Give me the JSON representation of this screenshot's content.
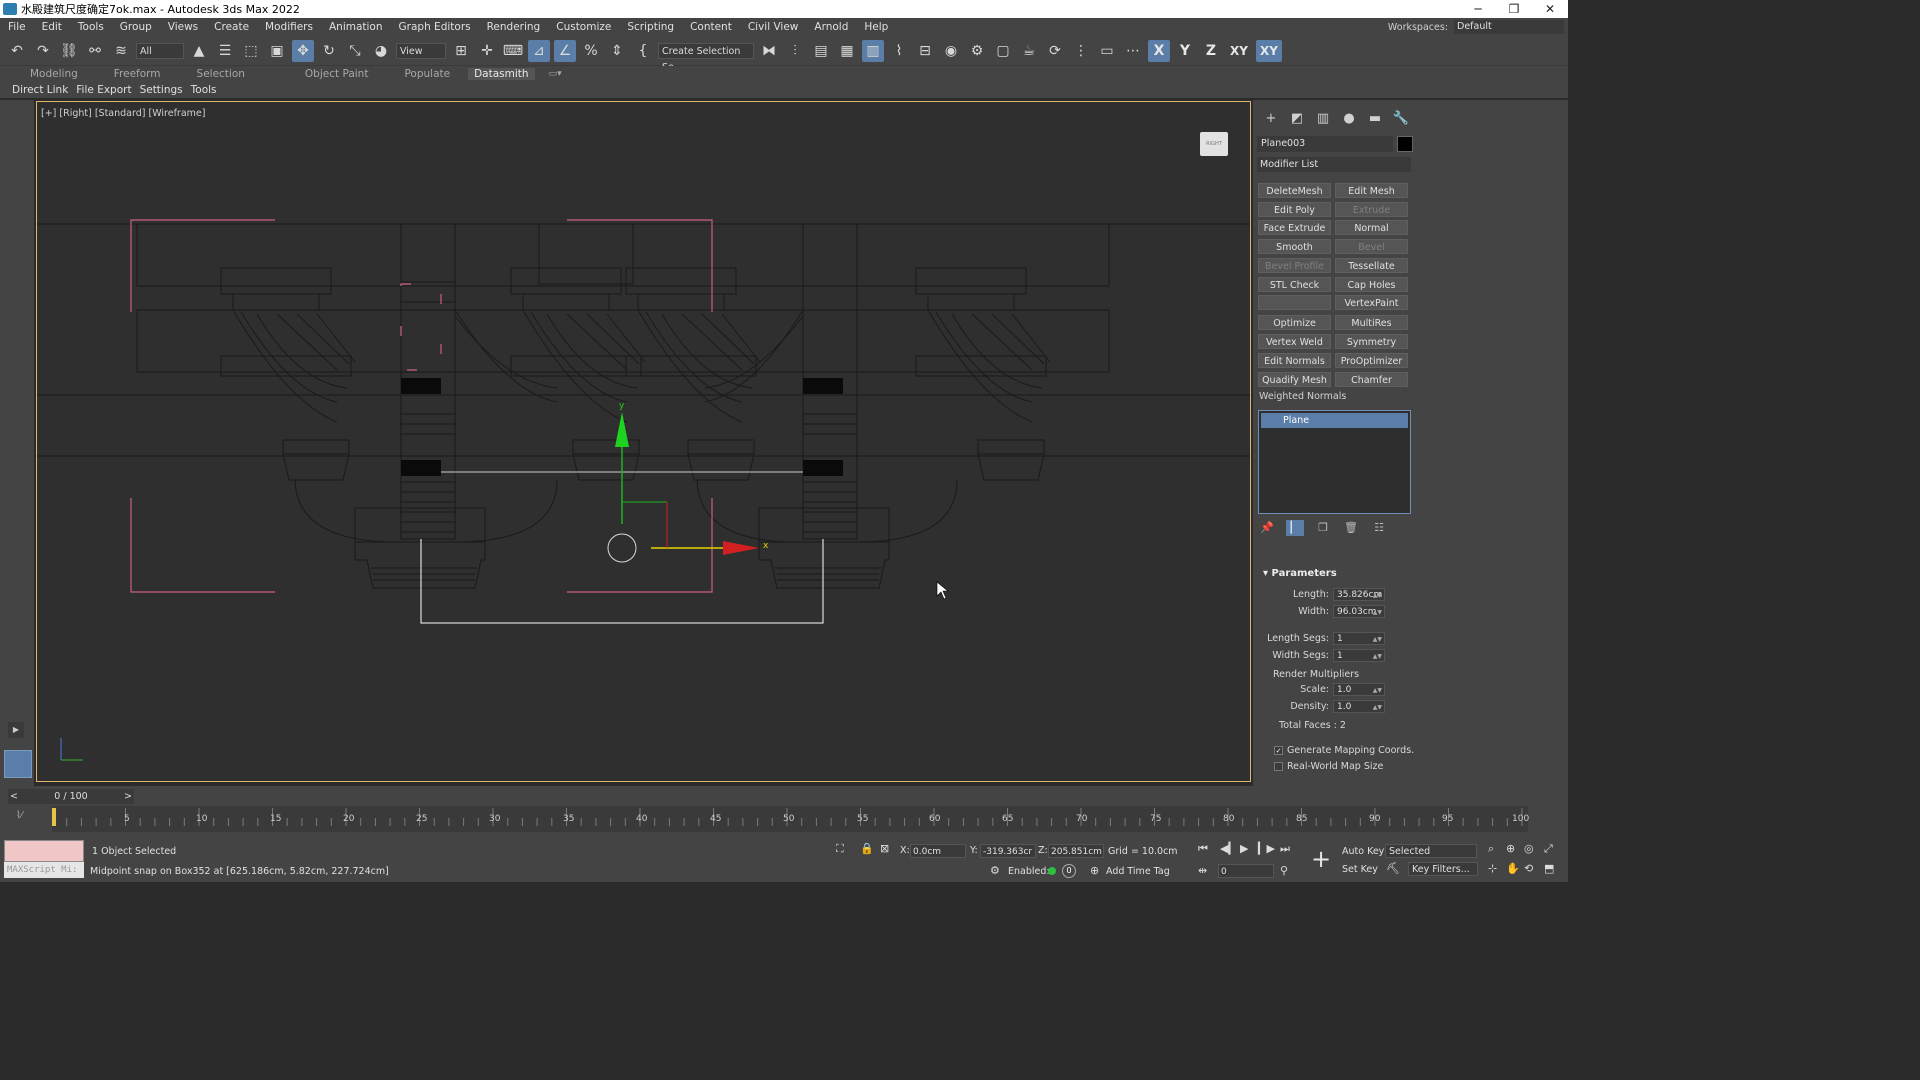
{
  "window": {
    "title": "水殿建筑尺度确定7ok.max - Autodesk 3ds Max 2022",
    "minimize": "─",
    "restore": "❐",
    "close": "✕"
  },
  "menu": [
    "File",
    "Edit",
    "Tools",
    "Group",
    "Views",
    "Create",
    "Modifiers",
    "Animation",
    "Graph Editors",
    "Rendering",
    "Customize",
    "Scripting",
    "Content",
    "Civil View",
    "Arnold",
    "Help"
  ],
  "workspaces": {
    "label": "Workspaces:",
    "value": "Default"
  },
  "toolbar": {
    "filter_value": "All",
    "coord_system": "View",
    "selection_set_placeholder": "Create Selection Se",
    "axis": [
      "X",
      "Y",
      "Z",
      "XY",
      "XY"
    ]
  },
  "ribbon_tabs": [
    "Modeling",
    "Freeform",
    "Selection",
    "Object Paint",
    "Populate",
    "Datasmith"
  ],
  "ribbon_active": "Datasmith",
  "datasmith_menu": [
    "Direct Link",
    "File Export",
    "Settings",
    "Tools"
  ],
  "viewport": {
    "label": "[+] [Right] [Standard] [Wireframe]",
    "viewcube_label": "RIGHT",
    "gizmo_x": "x",
    "gizmo_y": "y"
  },
  "command_panel": {
    "object_name": "Plane003",
    "object_color": "#000000",
    "modifier_list": "Modifier List",
    "modifier_buttons": [
      {
        "label": "DeleteMesh",
        "enabled": true
      },
      {
        "label": "Edit Mesh",
        "enabled": true
      },
      {
        "label": "Edit Poly",
        "enabled": true
      },
      {
        "label": "Extrude",
        "enabled": false
      },
      {
        "label": "Face Extrude",
        "enabled": true
      },
      {
        "label": "Normal",
        "enabled": true
      },
      {
        "label": "Smooth",
        "enabled": true
      },
      {
        "label": "Bevel",
        "enabled": false
      },
      {
        "label": "Bevel Profile",
        "enabled": false
      },
      {
        "label": "Tessellate",
        "enabled": true
      },
      {
        "label": "STL Check",
        "enabled": true
      },
      {
        "label": "Cap Holes",
        "enabled": true
      },
      {
        "label": "",
        "enabled": false
      },
      {
        "label": "VertexPaint",
        "enabled": true
      },
      {
        "label": "Optimize",
        "enabled": true
      },
      {
        "label": "MultiRes",
        "enabled": true
      },
      {
        "label": "Vertex Weld",
        "enabled": true
      },
      {
        "label": "Symmetry",
        "enabled": true
      },
      {
        "label": "Edit Normals",
        "enabled": true
      },
      {
        "label": "ProOptimizer",
        "enabled": true
      },
      {
        "label": "Quadify Mesh",
        "enabled": true
      },
      {
        "label": "Chamfer",
        "enabled": true
      }
    ],
    "weighted_normals": "Weighted Normals",
    "stack": [
      "Plane"
    ],
    "parameters": {
      "title": "Parameters",
      "length_label": "Length:",
      "length": "35.826cm",
      "width_label": "Width:",
      "width": "96.03cm",
      "length_segs_label": "Length Segs:",
      "length_segs": "1",
      "width_segs_label": "Width Segs:",
      "width_segs": "1",
      "render_multipliers": "Render Multipliers",
      "scale_label": "Scale:",
      "scale": "1.0",
      "density_label": "Density:",
      "density": "1.0",
      "total_faces": "Total Faces : 2",
      "generate_mapping": "Generate Mapping Coords.",
      "generate_mapping_checked": true,
      "real_world": "Real-World Map Size",
      "real_world_checked": false
    }
  },
  "timeline": {
    "slider": "0 / 100",
    "ticks": [
      "5",
      "10",
      "15",
      "20",
      "25",
      "30",
      "35",
      "40",
      "45",
      "50",
      "55",
      "60",
      "65",
      "70",
      "75",
      "80",
      "85",
      "90",
      "95",
      "100"
    ]
  },
  "status": {
    "maxscript": "MAXScript Mi:",
    "objects_selected": "1 Object Selected",
    "prompt": "Midpoint snap on Box352 at [625.186cm, 5.82cm, 227.724cm]",
    "x_label": "X:",
    "x": "0.0cm",
    "y_label": "Y:",
    "y": "-319.363cr",
    "z_label": "Z:",
    "z": "205.851cm",
    "grid": "Grid = 10.0cm",
    "enabled_label": "Enabled:",
    "enabled_value": "0",
    "add_time_tag": "Add Time Tag",
    "auto_key": "Auto Key",
    "set_key": "Set Key",
    "selected_dropdown": "Selected",
    "key_filters": "Key Filters...",
    "frame": "0"
  }
}
